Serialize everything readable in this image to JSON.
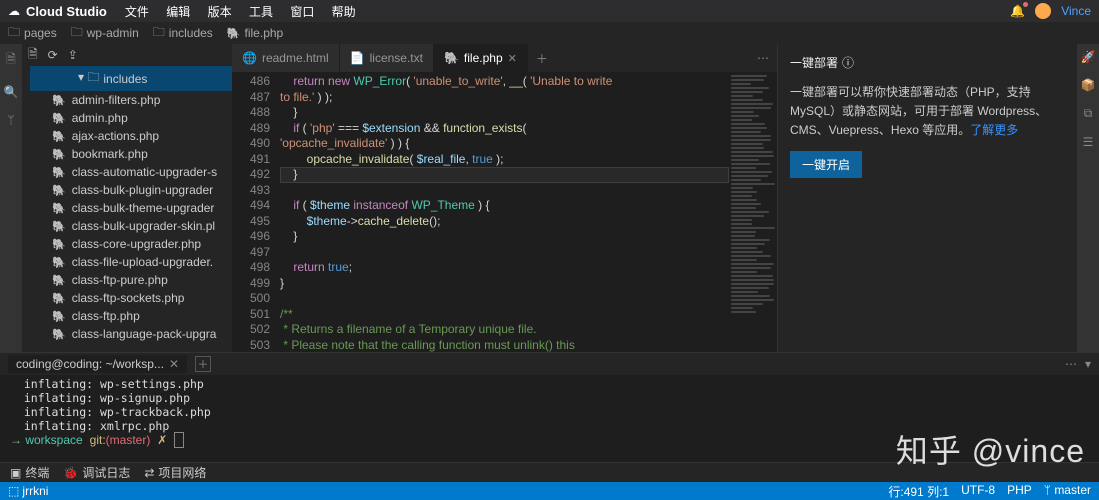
{
  "titlebar": {
    "brand": "Cloud Studio",
    "menus": [
      "文件",
      "编辑",
      "版本",
      "工具",
      "窗口",
      "帮助"
    ],
    "user": "Vince"
  },
  "breadcrumbs": [
    "pages",
    "wp-admin",
    "includes",
    "file.php"
  ],
  "sidebar": {
    "folder": "includes",
    "files": [
      "admin-filters.php",
      "admin.php",
      "ajax-actions.php",
      "bookmark.php",
      "class-automatic-upgrader-s",
      "class-bulk-plugin-upgrader",
      "class-bulk-theme-upgrader",
      "class-bulk-upgrader-skin.pl",
      "class-core-upgrader.php",
      "class-file-upload-upgrader.",
      "class-ftp-pure.php",
      "class-ftp-sockets.php",
      "class-ftp.php",
      "class-language-pack-upgra"
    ]
  },
  "tabs": [
    {
      "label": "readme.html",
      "icon": "🌐"
    },
    {
      "label": "license.txt",
      "icon": "📄"
    },
    {
      "label": "file.php",
      "icon": "🐘",
      "active": true
    }
  ],
  "code": {
    "line_start": 487,
    "line_count": 17,
    "hl_index": 5,
    "top_fragment": "    return new WP_Error( 'unable_to_write', __( 'Unable to write\\n to file.' ) );"
  },
  "rightpanel": {
    "title": "一键部署",
    "body": "一键部署可以帮你快速部署动态（PHP，支持 MySQL）或静态网站，可用于部署 Wordpress、CMS、Vuepress、Hexo 等应用。",
    "link": "了解更多",
    "button": "一键开启"
  },
  "terminal": {
    "tab": "coding@coding: ~/worksp...",
    "lines": [
      "inflating: wp-settings.php",
      "inflating: wp-signup.php",
      "inflating: wp-trackback.php",
      "inflating: xmlrpc.php"
    ],
    "prompt_ws": "workspace",
    "prompt_git": "git:",
    "prompt_branch": "(master)",
    "prompt_x": "✗"
  },
  "bottombar": [
    "终端",
    "调试日志",
    "项目网络"
  ],
  "statusbar": {
    "left_icon": "⬚",
    "left": "jrrkni",
    "pos": "行:491 列:1",
    "encoding": "UTF-8",
    "lang": "PHP",
    "branch": "master"
  }
}
